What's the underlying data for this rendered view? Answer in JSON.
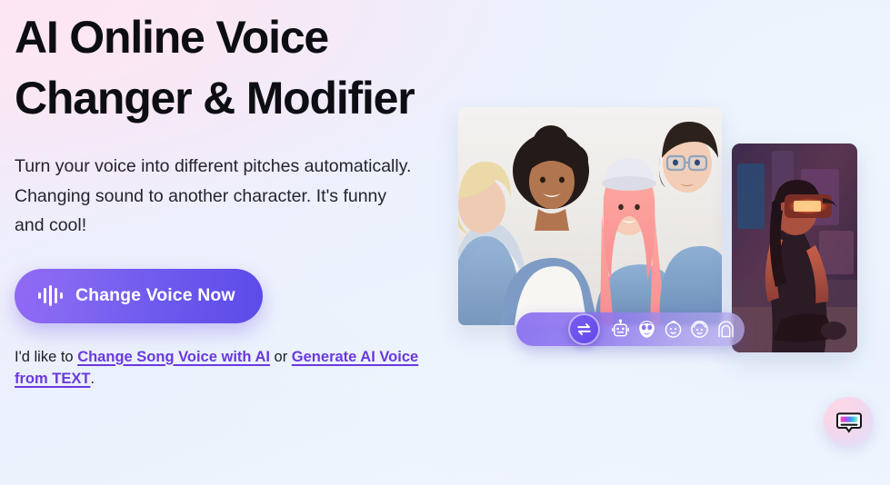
{
  "page": {
    "background_from": "#fbe9f3",
    "background_to": "#eff5fd"
  },
  "hero": {
    "headline": "AI Online Voice Changer & Modifier",
    "subcopy": "Turn your voice into different pitches automatically. Changing sound to another character. It's funny and cool!",
    "cta": {
      "label": "Change Voice Now",
      "icon": "waveform-icon",
      "gradient_from": "#9169f5",
      "gradient_to": "#5b4be8"
    },
    "alt_links": {
      "prefix": "I'd like to ",
      "link1": "Change Song Voice with AI",
      "separator": " or ",
      "link2": "Generate AI Voice from TEXT",
      "suffix": ".",
      "link_color": "#6a39de"
    }
  },
  "collage": {
    "photo_main_alt": "Four young people posing together against a white backdrop",
    "photo_side_alt": "Person wearing a glowing VR headset in a neon-lit room",
    "voice_bar": {
      "waveform_icon": "audio-waveform-icon",
      "swap_icon": "swap-arrows-icon",
      "voices": [
        {
          "name": "robot-voice-icon",
          "label": "Robot"
        },
        {
          "name": "monster-voice-icon",
          "label": "Monster"
        },
        {
          "name": "baby-voice-icon",
          "label": "Baby"
        },
        {
          "name": "male-voice-icon",
          "label": "Male"
        },
        {
          "name": "female-voice-icon",
          "label": "Female"
        }
      ]
    }
  },
  "chat": {
    "icon": "chat-bubble-icon",
    "label": "Open chat"
  }
}
